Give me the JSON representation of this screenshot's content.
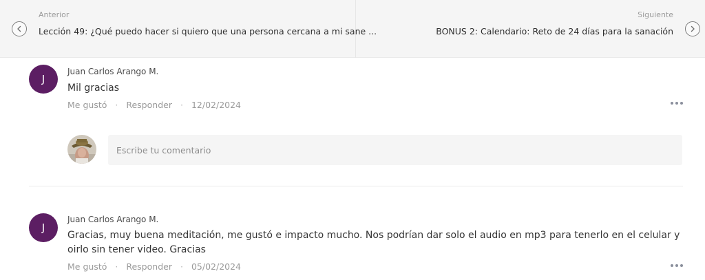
{
  "post_navigation": {
    "previous": {
      "kicker": "Anterior",
      "title": "Lección 49: ¿Qué puedo hacer si quiero que una persona cercana a mi sane ...",
      "icon": "chevron-left-icon"
    },
    "next": {
      "kicker": "Siguiente",
      "title": "BONUS 2: Calendario: Reto de 24 días para la sanación",
      "icon": "chevron-right-icon"
    }
  },
  "comments": [
    {
      "author": "Juan Carlos Arango M.",
      "avatar_initial": "J",
      "text": "Mil gracias",
      "like_label": "Me gustó",
      "reply_label": "Responder",
      "date": "12/02/2024"
    },
    {
      "author": "Juan Carlos Arango M.",
      "avatar_initial": "J",
      "text": "Gracias, muy buena meditación, me gustó e impacto mucho. Nos podrían dar solo el audio en mp3 para tenerlo en el celular y oirlo sin tener video. Gracias",
      "like_label": "Me gustó",
      "reply_label": "Responder",
      "date": "05/02/2024"
    }
  ],
  "reply_box": {
    "placeholder": "Escribe tu comentario"
  },
  "separator": "·",
  "colors": {
    "avatar_bg": "#5c1e63",
    "nav_bg": "#f5f5f5",
    "meta_text": "#9a9a9a"
  }
}
